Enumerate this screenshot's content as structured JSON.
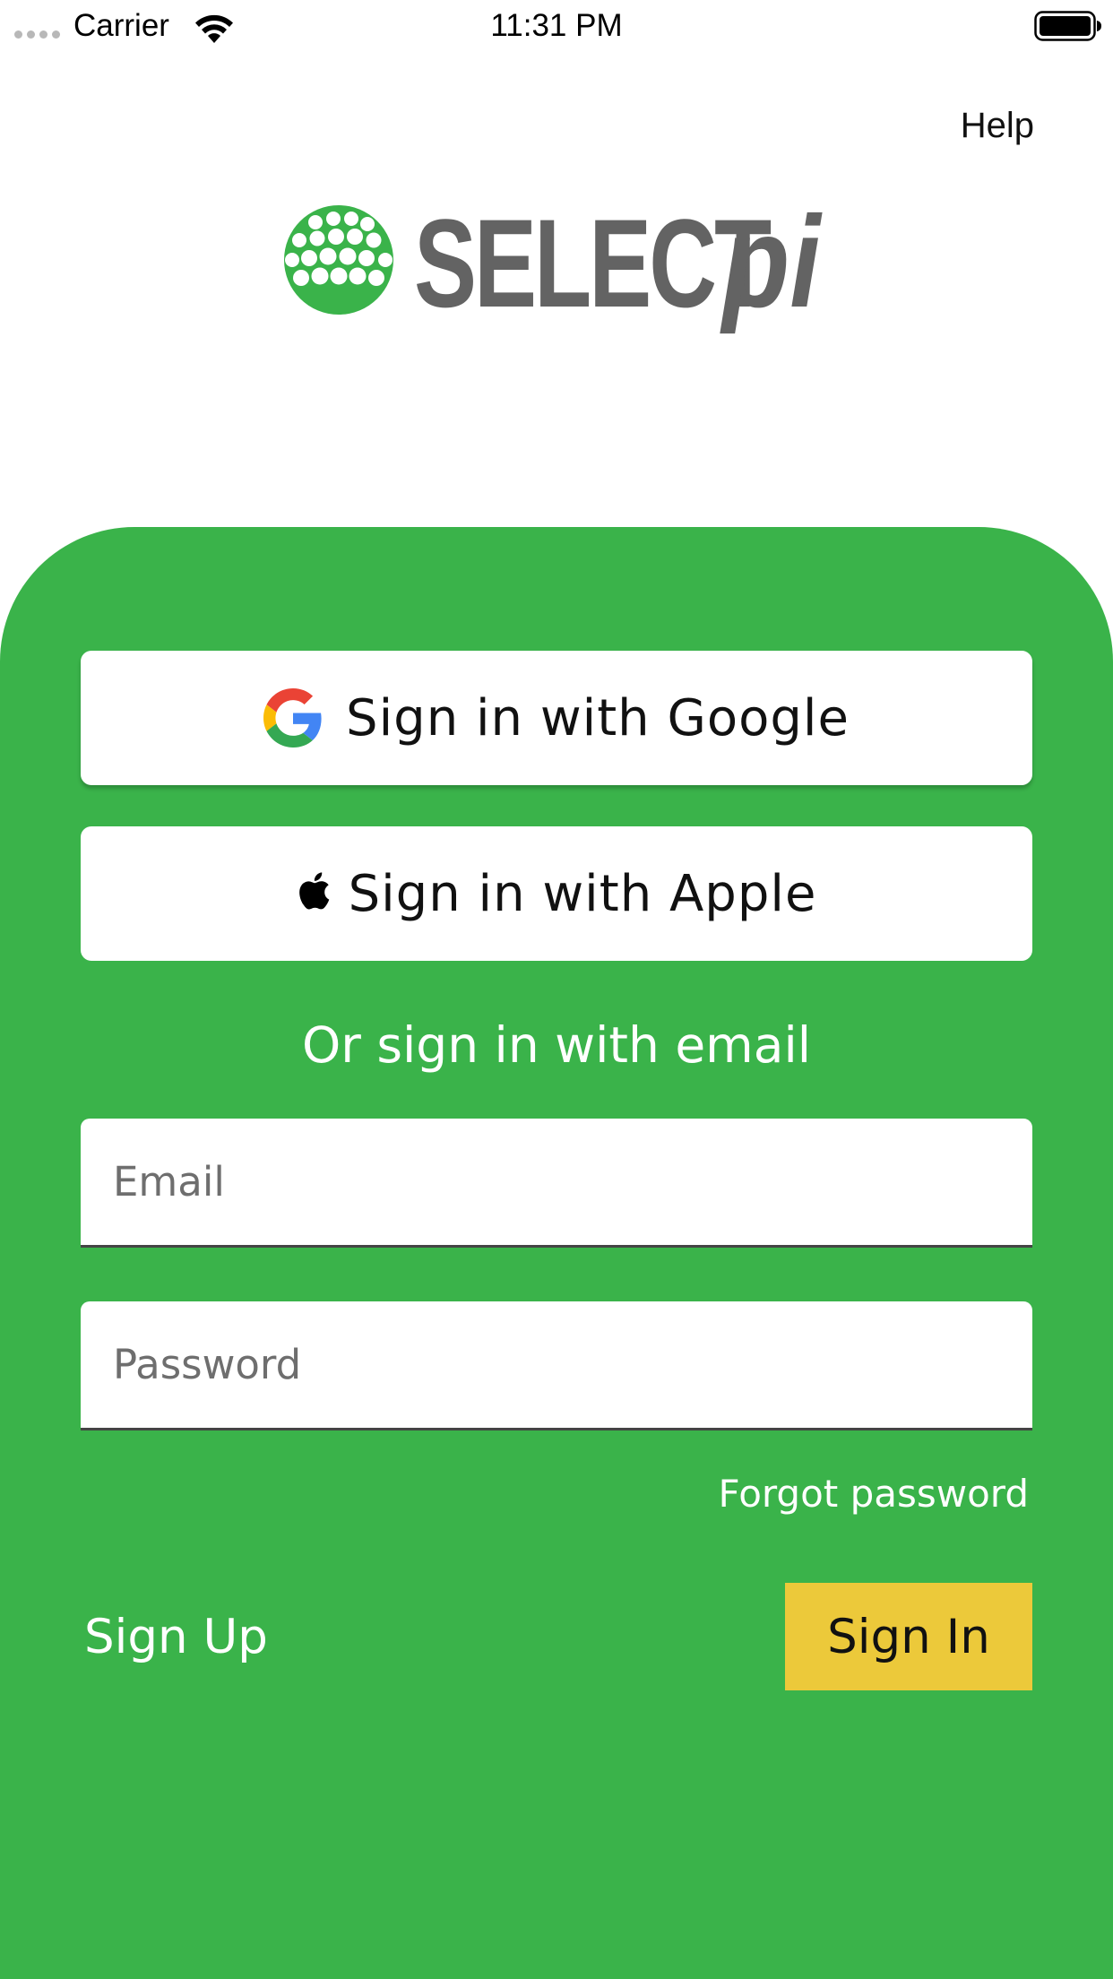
{
  "status_bar": {
    "carrier": "Carrier",
    "time": "11:31 PM"
  },
  "header": {
    "help_label": "Help"
  },
  "logo": {
    "wordmark_main": "SELECT",
    "wordmark_suffix": "pi",
    "ball_color": "#3ab34a",
    "text_color": "#636363"
  },
  "auth": {
    "google_label": "Sign in with Google",
    "apple_label": "Sign in with Apple",
    "divider_text": "Or sign in with email",
    "email_placeholder": "Email",
    "email_value": "",
    "password_placeholder": "Password",
    "password_value": "",
    "forgot_label": "Forgot password",
    "signup_label": "Sign Up",
    "signin_label": "Sign In"
  },
  "colors": {
    "panel_green": "#3ab34a",
    "signin_yellow": "#ecc93a"
  },
  "icons": {
    "google": "google-g-icon",
    "apple": "apple-icon",
    "wifi": "wifi-icon",
    "battery": "battery-icon"
  }
}
